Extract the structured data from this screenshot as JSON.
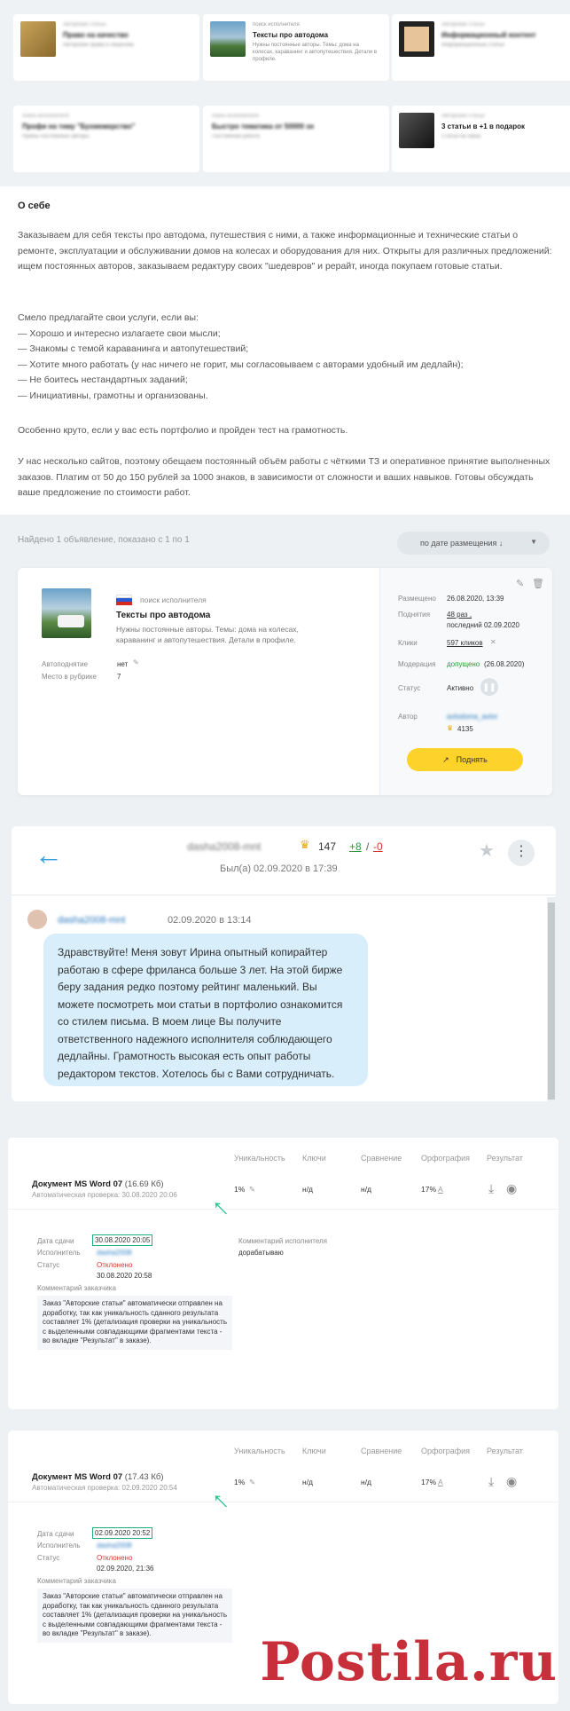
{
  "top_cards": [
    {
      "category": "Авторские статьи",
      "title": "Право на качество",
      "desc": "Авторские права и лицензии"
    },
    {
      "category": "поиск исполнителя",
      "title": "Тексты про автодома",
      "desc": "Нужны постоянные авторы. Темы: дома на колесах, караванинг и автопутешествия. Детали в профиле."
    },
    {
      "category": "Авторские статьи",
      "title": "Информационный контент",
      "desc": "Информационные статьи"
    },
    {
      "category": "поиск исполнителя",
      "title": "Профи на тему \"Бухмежерство\"",
      "desc": "Нужны постоянные авторы"
    },
    {
      "category": "поиск исполнителя",
      "title": "Быстро тематика от 50000 зн",
      "desc": "Постоянная работа"
    },
    {
      "category": "Авторские статьи",
      "title": "3 статьи в +1 в подарок",
      "desc": "Статьи на заказ"
    }
  ],
  "about": {
    "title": "О себе",
    "p1": "Заказываем для себя тексты про автодома, путешествия с ними, а также информационные и технические статьи о ремонте, эксплуатации и обслуживании домов на колесах и оборудования для них. Открыты для различных предложений: ищем постоянных авторов, заказываем редактуру своих \"шедевров\" и рерайт, иногда покупаем готовые статьи.",
    "p2_head": "Смело предлагайте свои услуги, если вы:",
    "p2_items": [
      "— Хорошо и интересно излагаете свои мысли;",
      "— Знакомы с темой караванинга и автопутешествий;",
      "— Хотите много работать (у нас ничего не горит, мы согласовываем с авторами удобный им дедлайн);",
      "— Не боитесь нестандартных заданий;",
      "— Инициативны, грамотны и организованы."
    ],
    "p3": "Особенно круто, если у вас есть портфолио и пройден тест на грамотность.",
    "p4": "У нас несколько сайтов, поэтому обещаем постоянный объём работы с чёткими ТЗ и оперативное принятие выполненных заказов. Платим от 50 до 150 рублей за 1000 знаков, в зависимости от сложности и ваших навыков. Готовы обсуждать ваше предложение по стоимости работ."
  },
  "found": "Найдено 1 объявление, показано с 1 по 1",
  "sort": "по дате размещения ↓",
  "listing": {
    "category": "поиск исполнителя",
    "title": "Тексты про автодома",
    "desc": "Нужны постоянные авторы. Темы: дома на колесах, караванинг и автопутешествия. Детали в профиле.",
    "autoraise_label": "Автоподнятие",
    "autoraise_val": "нет",
    "place_label": "Место в рубрике",
    "place_val": "7",
    "posted_label": "Размещено",
    "posted_val": "26.08.2020, 13:39",
    "raises_label": "Поднятия",
    "raises_val": "48 раз ,",
    "raises_last": "последний 02.09.2020",
    "clicks_label": "Клики",
    "clicks_val": "597 кликов",
    "moder_label": "Модерация",
    "moder_val": "допущено",
    "moder_date": "(26.08.2020)",
    "status_label": "Статус",
    "status_val": "Активно",
    "author_label": "Автор",
    "author_name": "avtodoma_avtor",
    "author_rating": "4135",
    "raise_btn": "Поднять"
  },
  "chat": {
    "username": "dasha2008-mnt",
    "rating": "147",
    "plus": "+8",
    "minus": "-0",
    "last_seen": "Был(а) 02.09.2020 в 17:39",
    "msg_user": "dasha2008-mnt",
    "msg_time": "02.09.2020 в 13:14",
    "msg_text": "Здравствуйте! Меня зовут Ирина опытный копирайтер работаю в сфере фриланса больше 3 лет. На этой бирже беру задания редко поэтому рейтинг маленький. Вы можете посмотреть мои статьи в портфолио ознакомится со стилем письма. В моем лице Вы получите ответственного надежного исполнителя соблюдающего дедлайны. Грамотность высокая есть опыт работы редактором текстов. Хотелось бы с Вами сотрудничать."
  },
  "headers": {
    "uniq": "Уникальность",
    "keys": "Ключи",
    "compare": "Сравнение",
    "spell": "Орфография",
    "result": "Результат"
  },
  "docs": [
    {
      "name": "Документ MS Word 07",
      "size": "(16.69 Кб)",
      "auto": "Автоматическая проверка: 30.08.2020 20:06",
      "uniq": "1%",
      "keys": "н/д",
      "compare": "н/д",
      "spell": "17%",
      "date_label": "Дата сдачи",
      "date_val": "30.08.2020 20:05",
      "exec_label": "Исполнитель",
      "exec_val": "dasha2008",
      "status_label": "Статус",
      "status_val": "Отклонено",
      "status_date": "30.08.2020 20:58",
      "exec_comment_label": "Комментарий исполнителя",
      "exec_comment": "дорабатываю",
      "cust_comment_label": "Комментарий заказчика",
      "cust_comment": "Заказ \"Авторские статьи\" автоматически отправлен на доработку, так как уникальность сданного результата составляет 1% (детализация проверки на уникальность с выделенными совпадающими фрагментами текста - во вкладке \"Результат\" в заказе)."
    },
    {
      "name": "Документ MS Word 07",
      "size": "(17.43 Кб)",
      "auto": "Автоматическая проверка: 02.09.2020 20:54",
      "uniq": "1%",
      "keys": "н/д",
      "compare": "н/д",
      "spell": "17%",
      "date_label": "Дата сдачи",
      "date_val": "02.09.2020 20:52",
      "exec_label": "Исполнитель",
      "exec_val": "dasha2008",
      "status_label": "Статус",
      "status_val": "Отклонено",
      "status_date": "02.09.2020, 21:36",
      "cust_comment_label": "Комментарий заказчика",
      "cust_comment": "Заказ \"Авторские статьи\" автоматически отправлен на доработку, так как уникальность сданного результата составляет 1% (детализация проверки на уникальность с выделенными совпадающими фрагментами текста - во вкладке \"Результат\" в заказе)."
    }
  ],
  "watermark": "Postila.ru",
  "colors": {
    "accent_yellow": "#fdd22a",
    "status_red": "#d9342b",
    "link_blue": "#2a7bc0",
    "highlight_green": "#1fb07a",
    "bubble": "#d8eefb"
  }
}
